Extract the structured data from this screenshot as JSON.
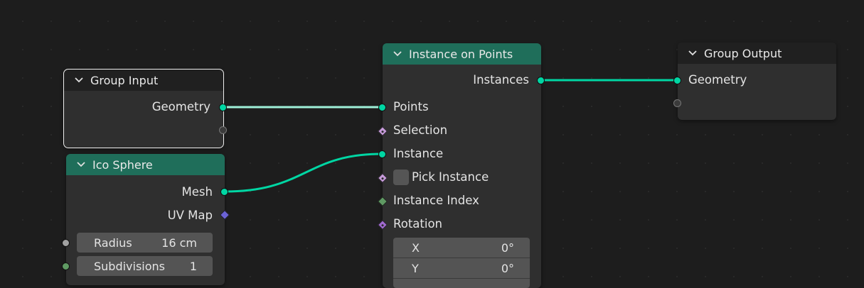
{
  "nodes": {
    "group_input": {
      "title": "Group Input",
      "outputs": [
        "Geometry"
      ]
    },
    "ico_sphere": {
      "title": "Ico Sphere",
      "outputs": [
        "Mesh",
        "UV Map"
      ],
      "fields": [
        {
          "label": "Radius",
          "value": "16 cm"
        },
        {
          "label": "Subdivisions",
          "value": "1"
        }
      ]
    },
    "instance_on_points": {
      "title": "Instance on Points",
      "outputs": [
        "Instances"
      ],
      "inputs": [
        "Points",
        "Selection",
        "Instance",
        "Pick Instance",
        "Instance Index",
        "Rotation"
      ],
      "rotation": [
        {
          "axis": "X",
          "value": "0°"
        },
        {
          "axis": "Y",
          "value": "0°"
        }
      ]
    },
    "group_output": {
      "title": "Group Output",
      "inputs": [
        "Geometry"
      ]
    }
  },
  "colors": {
    "geometry_socket": "#00d6a3",
    "node_header_geometry": "#1f6e5a",
    "node_header_group": "#202020",
    "node_body": "#2f2f2f",
    "link_selected": "#9ff0d8",
    "link": "#00d6a3"
  }
}
